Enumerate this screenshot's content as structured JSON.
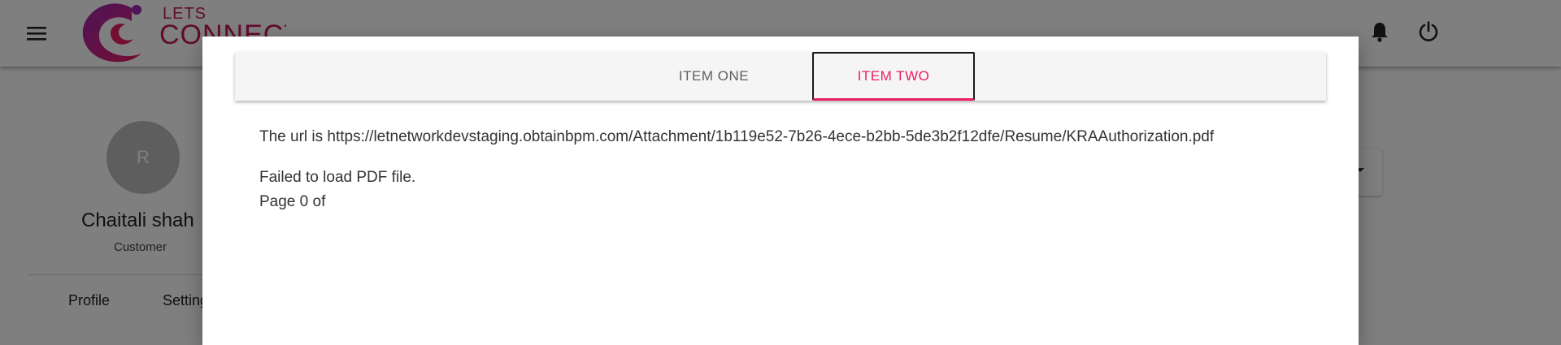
{
  "app": {
    "logo_top": "LETS",
    "logo_bottom": "CONNECT",
    "icons": {
      "menu": "hamburger-menu-icon",
      "notifications": "bell-icon",
      "logout": "power-icon"
    },
    "colors": {
      "brand": "#c2185b",
      "accent": "#e91e63"
    }
  },
  "profile": {
    "avatar_initial": "R",
    "name": "Chaitali shah",
    "role": "Customer",
    "tabs": [
      {
        "label": "Profile"
      },
      {
        "label": "Setting"
      }
    ]
  },
  "modal": {
    "tabs": [
      {
        "label": "ITEM ONE",
        "selected": false
      },
      {
        "label": "ITEM TWO",
        "selected": true
      }
    ],
    "url_text": "The url is https://letnetworkdevstaging.obtainbpm.com/Attachment/1b119e52-7b26-4ece-b2bb-5de3b2f12dfe/Resume/KRAAuthorization.pdf",
    "error_text": "Failed to load PDF file.",
    "page_text": "Page 0 of"
  }
}
